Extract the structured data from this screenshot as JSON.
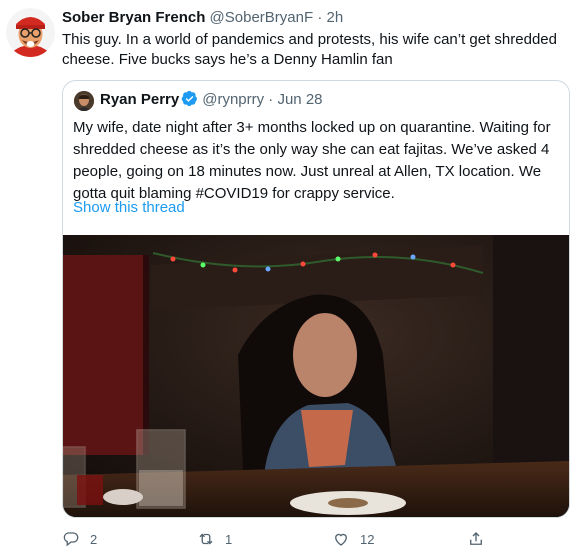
{
  "tweet": {
    "author_name": "Sober Bryan French",
    "handle": "@SoberBryanF",
    "separator": "·",
    "time": "2h",
    "text": "This guy. In a world of pandemics and protests, his wife can’t get shredded cheese. Five bucks says he’s a Denny Hamlin fan"
  },
  "quoted": {
    "author_name": "Ryan Perry",
    "handle": "@rynprry",
    "separator": "·",
    "date": "Jun 28",
    "text": "My wife, date night after 3+ months locked up on quarantine. Waiting for shredded cheese as it’s the only way she can eat fajitas. We’ve asked 4 people, going on 18 minutes now. Just unreal at Allen, TX location. We gotta quit blaming #COVID19 for crappy service.",
    "show_thread": "Show this thread",
    "verified_icon": "verified-badge-icon"
  },
  "actions": {
    "reply_count": "2",
    "retweet_count": "1",
    "like_count": "12"
  },
  "colors": {
    "link": "#1d9bf0",
    "muted": "#536471",
    "border": "#cfd9de"
  }
}
